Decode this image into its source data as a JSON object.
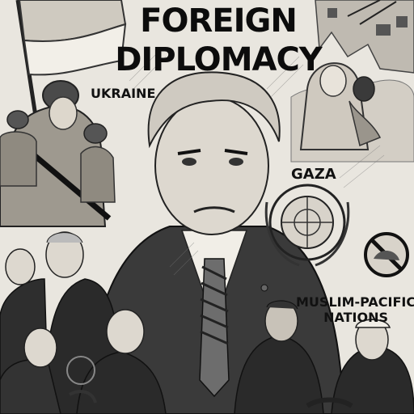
{
  "poster": {
    "title_line1": "FOREIGN",
    "title_line2": "DIPLOMACY",
    "labels": {
      "ukraine": "UKRAINE",
      "gaza": "GAZA",
      "muslim_pacific_line1": "MUSLIM-PACIFIC",
      "muslim_pacific_line2": "NATIONS"
    }
  },
  "colors": {
    "paper": "#e9e6df",
    "ink": "#111111",
    "mid_gray": "#8a8a8a",
    "dark_suit": "#2a2a2a"
  },
  "icons": [
    "un-emblem-icon",
    "prohibition-sign-icon",
    "flag-icon"
  ]
}
